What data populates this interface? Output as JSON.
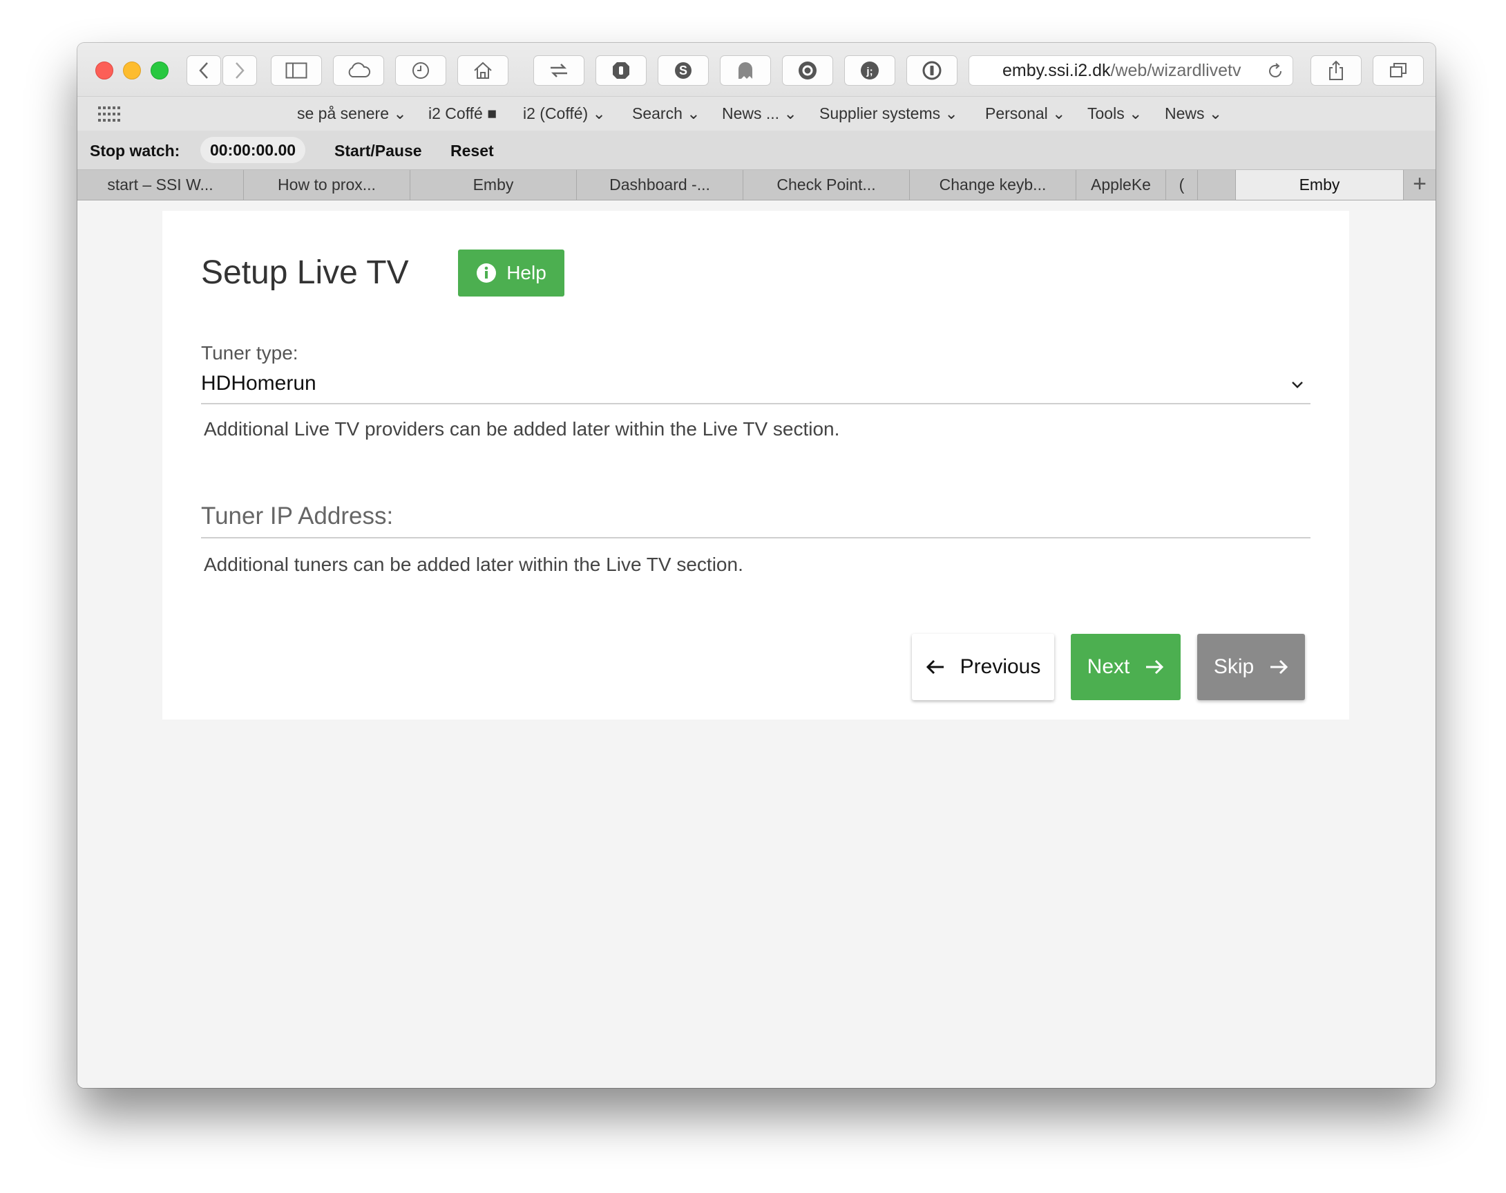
{
  "browser": {
    "url_host": "emby.ssi.i2.dk",
    "url_path": "/web/wizardlivetv"
  },
  "bookmarks": [
    "se på senere ⌄",
    "i2 Coffé ■",
    "i2 (Coffé) ⌄",
    "Search ⌄",
    "News ... ⌄",
    "Supplier systems ⌄",
    "Personal ⌄",
    "Tools ⌄",
    "News ⌄"
  ],
  "stopwatch": {
    "label": "Stop watch:",
    "time": "00:00:00.00",
    "start_pause": "Start/Pause",
    "reset": "Reset"
  },
  "tabs": [
    {
      "label": "start – SSI W..."
    },
    {
      "label": "How to prox..."
    },
    {
      "label": "Emby"
    },
    {
      "label": "Dashboard -..."
    },
    {
      "label": "Check Point..."
    },
    {
      "label": "Change keyb..."
    },
    {
      "label": "AppleKe"
    },
    {
      "label": "("
    },
    {
      "label": "Emby",
      "active": true
    }
  ],
  "tab_add": "+",
  "page": {
    "title": "Setup Live TV",
    "help_label": "Help",
    "tuner_type_label": "Tuner type:",
    "tuner_type_value": "HDHomerun",
    "tuner_type_hint": "Additional Live TV providers can be added later within the Live TV section.",
    "tuner_ip_label": "Tuner IP Address:",
    "tuner_ip_value": "",
    "tuner_ip_hint": "Additional tuners can be added later within the Live TV section.",
    "previous_label": "Previous",
    "next_label": "Next",
    "skip_label": "Skip"
  },
  "colors": {
    "accent_green": "#4caf50",
    "skip_gray": "#8a8a8a"
  }
}
